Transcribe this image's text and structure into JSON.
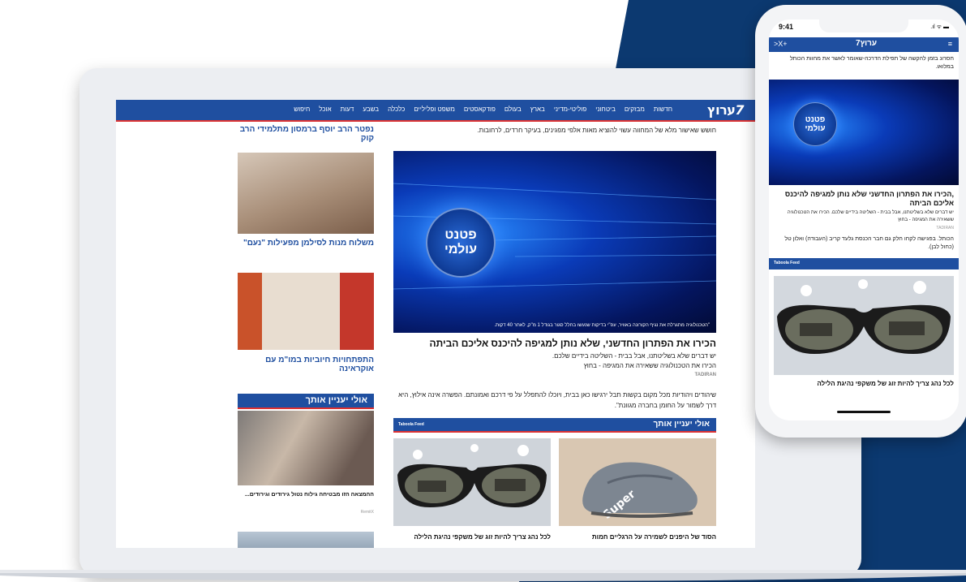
{
  "site": {
    "logo": "ערוץ",
    "logo_seven": "7",
    "nav": [
      "חדשות",
      "מבזקים",
      "ביטחוני",
      "פוליטי-מדיני",
      "בארץ",
      "בעולם",
      "פודקאסטים",
      "משפט ופליליים",
      "כלכלה",
      "בשבע",
      "דעות",
      "אוכל",
      "חיפוש"
    ]
  },
  "main": {
    "top_text": "חושש שאישור מלא של המחווה עשוי להוציא מאות אלפי מפגינים, בעיקר חרדים, לרחובות.",
    "hero_badge": [
      "פטנט",
      "עולמי"
    ],
    "hero_caption": "\"הטכנולוגיה מתגרלת את נגיף הקורונה באוויר, עפ\"י בדיקות שנעשו בחלל סגור בגודל 1 מ\"ק, לאחר 40 דקות.",
    "headline": "הכירו את הפתרון החדשני, שלא נותן למגיפה להיכנס אליכם הביתה",
    "sub1": "יש דברים שלא בשליטתנו, אבל בבית - השליטה בידיים שלכם.",
    "sub2": "הכירו את הטכנולוגיה ששאירה את המגיפה - בחוץ",
    "advertiser": "TADIRAN",
    "paragraph": "שיהודים ויהודיות מכל מקום בקשות תבל ירגישו כאן בבית, ויוכלו להתפלל על פי דרכם ואמונתם. הפשרה אינה אילוץ, היא דרך לשמור על החומן בחברה מגוונת\".",
    "maybe_title": "אולי יעניין אותך",
    "taboola": "Taboola Feed",
    "cards": [
      {
        "caption": "הסוד של היפנים לשמירה על הרגליים חמות"
      },
      {
        "caption": "לכל נהג צריך להיות זוג של משקפי נהיגת הלילה"
      }
    ]
  },
  "sidebar": {
    "head1": "נפטר הרב יוסף ברמסון מתלמידי הרב קוק",
    "cap1": "משלוח מנות לסילמן מפעילות \"נעם\"",
    "cap2": "התפתחויות חיוביות במו\"מ עם אוקראינה",
    "maybe_title": "אולי יעניין אותך",
    "cap3": "ההמצאה הזו מבטיחה גילוח נטול גירודים וגירודים...",
    "source": "RemitX"
  },
  "phone": {
    "time": "9:41",
    "signal": ".ıl ᯤ ▬",
    "logo": "ערוץ7",
    "close": "+X<",
    "menu": "≡",
    "top_text": "חסרונ בזמן להקשה של תפילת הדרכה-שאומר לאשר את מחוות הכותל במלואו.",
    "badge": [
      "פטנט",
      "עולמי"
    ],
    "headline": ",הכירו את הפתרון החדשני שלא נותן למגיפה להיכנס אליכם הביתה",
    "sub": "יש דברים שלא בשליטתנו, אבל בבית - השליטה בידיים שלכם. הכירו את הטכנולוגיה ששאירה את המגיפה - בחוץ",
    "advertiser": "TADIRAN",
    "paragraph": "הכותל. בפגישה לקחו חלק גם חבר הכנסת גלעד קריב (העבודה) ואלון טל (כחול לבן).",
    "taboola": "Taboola Feed",
    "caption": "לכל נהג צריך להיות זוג של משקפי נהיגת הלילה"
  }
}
